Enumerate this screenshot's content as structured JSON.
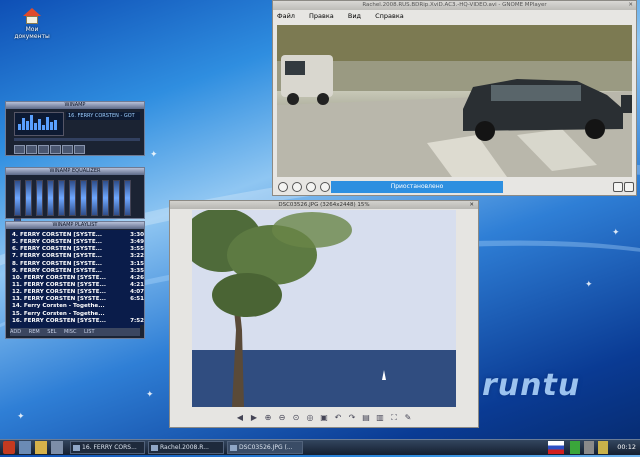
{
  "desktop": {
    "icon_label": "Мои документы",
    "logo": "runtu"
  },
  "winamp": {
    "main": {
      "title": "WINAMP",
      "track_info": "16. FERRY CORSTEN - GOT"
    },
    "equalizer": {
      "title": "WINAMP EQUALIZER"
    },
    "playlist": {
      "title": "WINAMP PLAYLIST",
      "tracks": [
        {
          "title": "4. FERRY CORSTEN [SYSTE...",
          "time": "3:30"
        },
        {
          "title": "5. FERRY CORSTEN [SYSTE...",
          "time": "3:49"
        },
        {
          "title": "6. FERRY CORSTEN [SYSTE...",
          "time": "3:55"
        },
        {
          "title": "7. FERRY CORSTEN [SYSTE...",
          "time": "3:22"
        },
        {
          "title": "8. FERRY CORSTEN [SYSTE...",
          "time": "3:15"
        },
        {
          "title": "9. FERRY CORSTEN [SYSTE...",
          "time": "3:35"
        },
        {
          "title": "10. FERRY CORSTEN [SYSTE...",
          "time": "4:26"
        },
        {
          "title": "11. FERRY CORSTEN [SYSTE...",
          "time": "4:21"
        },
        {
          "title": "12. FERRY CORSTEN [SYSTE...",
          "time": "4:07"
        },
        {
          "title": "13. FERRY CORSTEN [SYSTE...",
          "time": "6:51"
        },
        {
          "title": "14. Ferry Corsten - Togethe...",
          "time": ""
        },
        {
          "title": "15. Ferry Corsten - Togethe...",
          "time": ""
        },
        {
          "title": "16. FERRY CORSTEN [SYSTE...",
          "time": "7:52"
        }
      ],
      "buttons": [
        "ADD",
        "REM",
        "SEL",
        "MISC",
        "LIST"
      ]
    }
  },
  "mplayer": {
    "title": "Rachel.2008.RUS.BDRip.XviD.AC3.-HQ-VIDEO.avi - GNOME MPlayer",
    "menu": [
      "Файл",
      "Правка",
      "Вид",
      "Справка"
    ],
    "status": "Приостановлено",
    "color_accent": "#2d8fe0"
  },
  "viewer": {
    "title": "DSC03526.JPG (3264x2448) 15%"
  },
  "taskbar": {
    "tasks": [
      {
        "label": "16. FERRY CORS..."
      },
      {
        "label": "Rachel.2008.R..."
      },
      {
        "label": "DSC03526.JPG (..."
      }
    ],
    "clock": "00:12",
    "layout_flag": "ru"
  }
}
